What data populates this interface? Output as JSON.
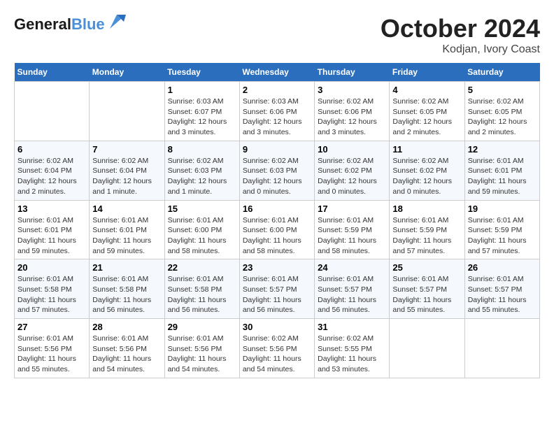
{
  "header": {
    "logo_line1": "General",
    "logo_line2": "Blue",
    "month": "October 2024",
    "location": "Kodjan, Ivory Coast"
  },
  "days_of_week": [
    "Sunday",
    "Monday",
    "Tuesday",
    "Wednesday",
    "Thursday",
    "Friday",
    "Saturday"
  ],
  "weeks": [
    [
      {
        "day": "",
        "info": ""
      },
      {
        "day": "",
        "info": ""
      },
      {
        "day": "1",
        "info": "Sunrise: 6:03 AM\nSunset: 6:07 PM\nDaylight: 12 hours\nand 3 minutes."
      },
      {
        "day": "2",
        "info": "Sunrise: 6:03 AM\nSunset: 6:06 PM\nDaylight: 12 hours\nand 3 minutes."
      },
      {
        "day": "3",
        "info": "Sunrise: 6:02 AM\nSunset: 6:06 PM\nDaylight: 12 hours\nand 3 minutes."
      },
      {
        "day": "4",
        "info": "Sunrise: 6:02 AM\nSunset: 6:05 PM\nDaylight: 12 hours\nand 2 minutes."
      },
      {
        "day": "5",
        "info": "Sunrise: 6:02 AM\nSunset: 6:05 PM\nDaylight: 12 hours\nand 2 minutes."
      }
    ],
    [
      {
        "day": "6",
        "info": "Sunrise: 6:02 AM\nSunset: 6:04 PM\nDaylight: 12 hours\nand 2 minutes."
      },
      {
        "day": "7",
        "info": "Sunrise: 6:02 AM\nSunset: 6:04 PM\nDaylight: 12 hours\nand 1 minute."
      },
      {
        "day": "8",
        "info": "Sunrise: 6:02 AM\nSunset: 6:03 PM\nDaylight: 12 hours\nand 1 minute."
      },
      {
        "day": "9",
        "info": "Sunrise: 6:02 AM\nSunset: 6:03 PM\nDaylight: 12 hours\nand 0 minutes."
      },
      {
        "day": "10",
        "info": "Sunrise: 6:02 AM\nSunset: 6:02 PM\nDaylight: 12 hours\nand 0 minutes."
      },
      {
        "day": "11",
        "info": "Sunrise: 6:02 AM\nSunset: 6:02 PM\nDaylight: 12 hours\nand 0 minutes."
      },
      {
        "day": "12",
        "info": "Sunrise: 6:01 AM\nSunset: 6:01 PM\nDaylight: 11 hours\nand 59 minutes."
      }
    ],
    [
      {
        "day": "13",
        "info": "Sunrise: 6:01 AM\nSunset: 6:01 PM\nDaylight: 11 hours\nand 59 minutes."
      },
      {
        "day": "14",
        "info": "Sunrise: 6:01 AM\nSunset: 6:01 PM\nDaylight: 11 hours\nand 59 minutes."
      },
      {
        "day": "15",
        "info": "Sunrise: 6:01 AM\nSunset: 6:00 PM\nDaylight: 11 hours\nand 58 minutes."
      },
      {
        "day": "16",
        "info": "Sunrise: 6:01 AM\nSunset: 6:00 PM\nDaylight: 11 hours\nand 58 minutes."
      },
      {
        "day": "17",
        "info": "Sunrise: 6:01 AM\nSunset: 5:59 PM\nDaylight: 11 hours\nand 58 minutes."
      },
      {
        "day": "18",
        "info": "Sunrise: 6:01 AM\nSunset: 5:59 PM\nDaylight: 11 hours\nand 57 minutes."
      },
      {
        "day": "19",
        "info": "Sunrise: 6:01 AM\nSunset: 5:59 PM\nDaylight: 11 hours\nand 57 minutes."
      }
    ],
    [
      {
        "day": "20",
        "info": "Sunrise: 6:01 AM\nSunset: 5:58 PM\nDaylight: 11 hours\nand 57 minutes."
      },
      {
        "day": "21",
        "info": "Sunrise: 6:01 AM\nSunset: 5:58 PM\nDaylight: 11 hours\nand 56 minutes."
      },
      {
        "day": "22",
        "info": "Sunrise: 6:01 AM\nSunset: 5:58 PM\nDaylight: 11 hours\nand 56 minutes."
      },
      {
        "day": "23",
        "info": "Sunrise: 6:01 AM\nSunset: 5:57 PM\nDaylight: 11 hours\nand 56 minutes."
      },
      {
        "day": "24",
        "info": "Sunrise: 6:01 AM\nSunset: 5:57 PM\nDaylight: 11 hours\nand 56 minutes."
      },
      {
        "day": "25",
        "info": "Sunrise: 6:01 AM\nSunset: 5:57 PM\nDaylight: 11 hours\nand 55 minutes."
      },
      {
        "day": "26",
        "info": "Sunrise: 6:01 AM\nSunset: 5:57 PM\nDaylight: 11 hours\nand 55 minutes."
      }
    ],
    [
      {
        "day": "27",
        "info": "Sunrise: 6:01 AM\nSunset: 5:56 PM\nDaylight: 11 hours\nand 55 minutes."
      },
      {
        "day": "28",
        "info": "Sunrise: 6:01 AM\nSunset: 5:56 PM\nDaylight: 11 hours\nand 54 minutes."
      },
      {
        "day": "29",
        "info": "Sunrise: 6:01 AM\nSunset: 5:56 PM\nDaylight: 11 hours\nand 54 minutes."
      },
      {
        "day": "30",
        "info": "Sunrise: 6:02 AM\nSunset: 5:56 PM\nDaylight: 11 hours\nand 54 minutes."
      },
      {
        "day": "31",
        "info": "Sunrise: 6:02 AM\nSunset: 5:55 PM\nDaylight: 11 hours\nand 53 minutes."
      },
      {
        "day": "",
        "info": ""
      },
      {
        "day": "",
        "info": ""
      }
    ]
  ]
}
